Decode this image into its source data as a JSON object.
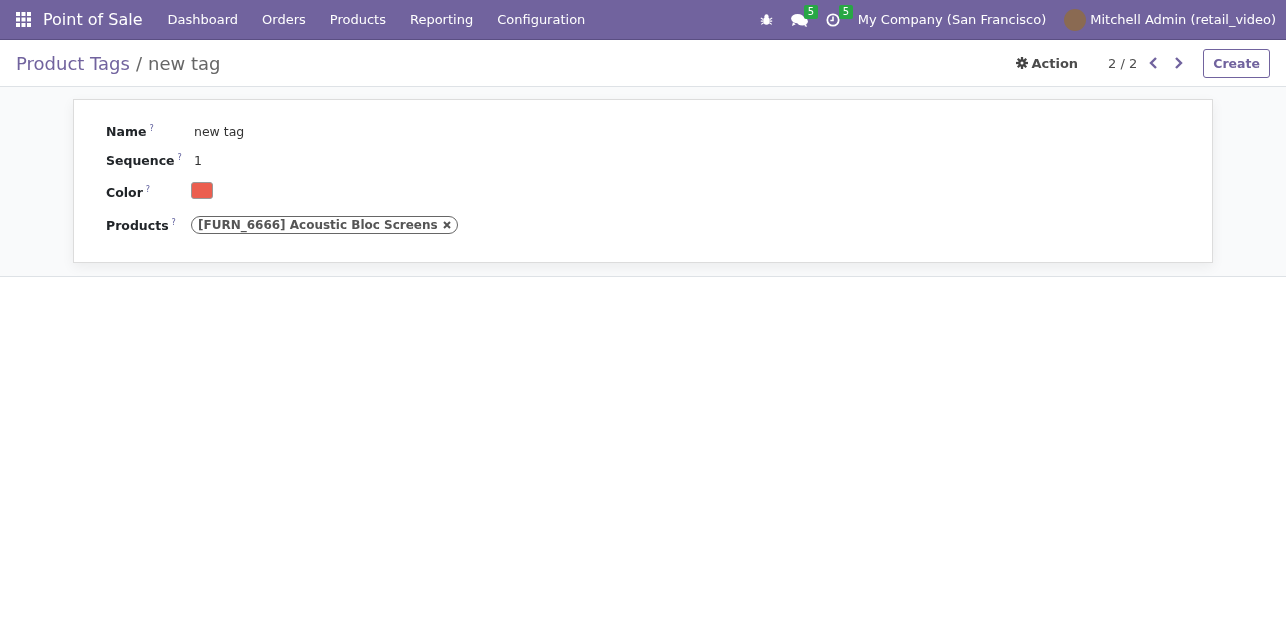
{
  "navbar": {
    "app_title": "Point of Sale",
    "menu": [
      "Dashboard",
      "Orders",
      "Products",
      "Reporting",
      "Configuration"
    ],
    "systray": [
      {
        "kind": "bug"
      },
      {
        "kind": "chat",
        "badge": "5"
      },
      {
        "kind": "clock",
        "badge": "5"
      }
    ],
    "company": "My Company (San Francisco)",
    "user": "Mitchell Admin (retail_video)"
  },
  "breadcrumb": {
    "parent": "Product Tags",
    "separator": "/",
    "current": "new tag"
  },
  "control_panel": {
    "action": "Action",
    "pager": "2 / 2",
    "create": "Create"
  },
  "form": {
    "fields": [
      {
        "kind": "text",
        "label": "Name",
        "help": "?",
        "value": "new tag"
      },
      {
        "kind": "text",
        "label": "Sequence",
        "help": "?",
        "value": "1"
      },
      {
        "kind": "color",
        "label": "Color",
        "help": "?",
        "color": "#eb5e4f"
      },
      {
        "kind": "tags",
        "label": "Products",
        "help": "?",
        "tags": [
          "[FURN_6666] Acoustic Bloc Screens"
        ]
      }
    ]
  }
}
